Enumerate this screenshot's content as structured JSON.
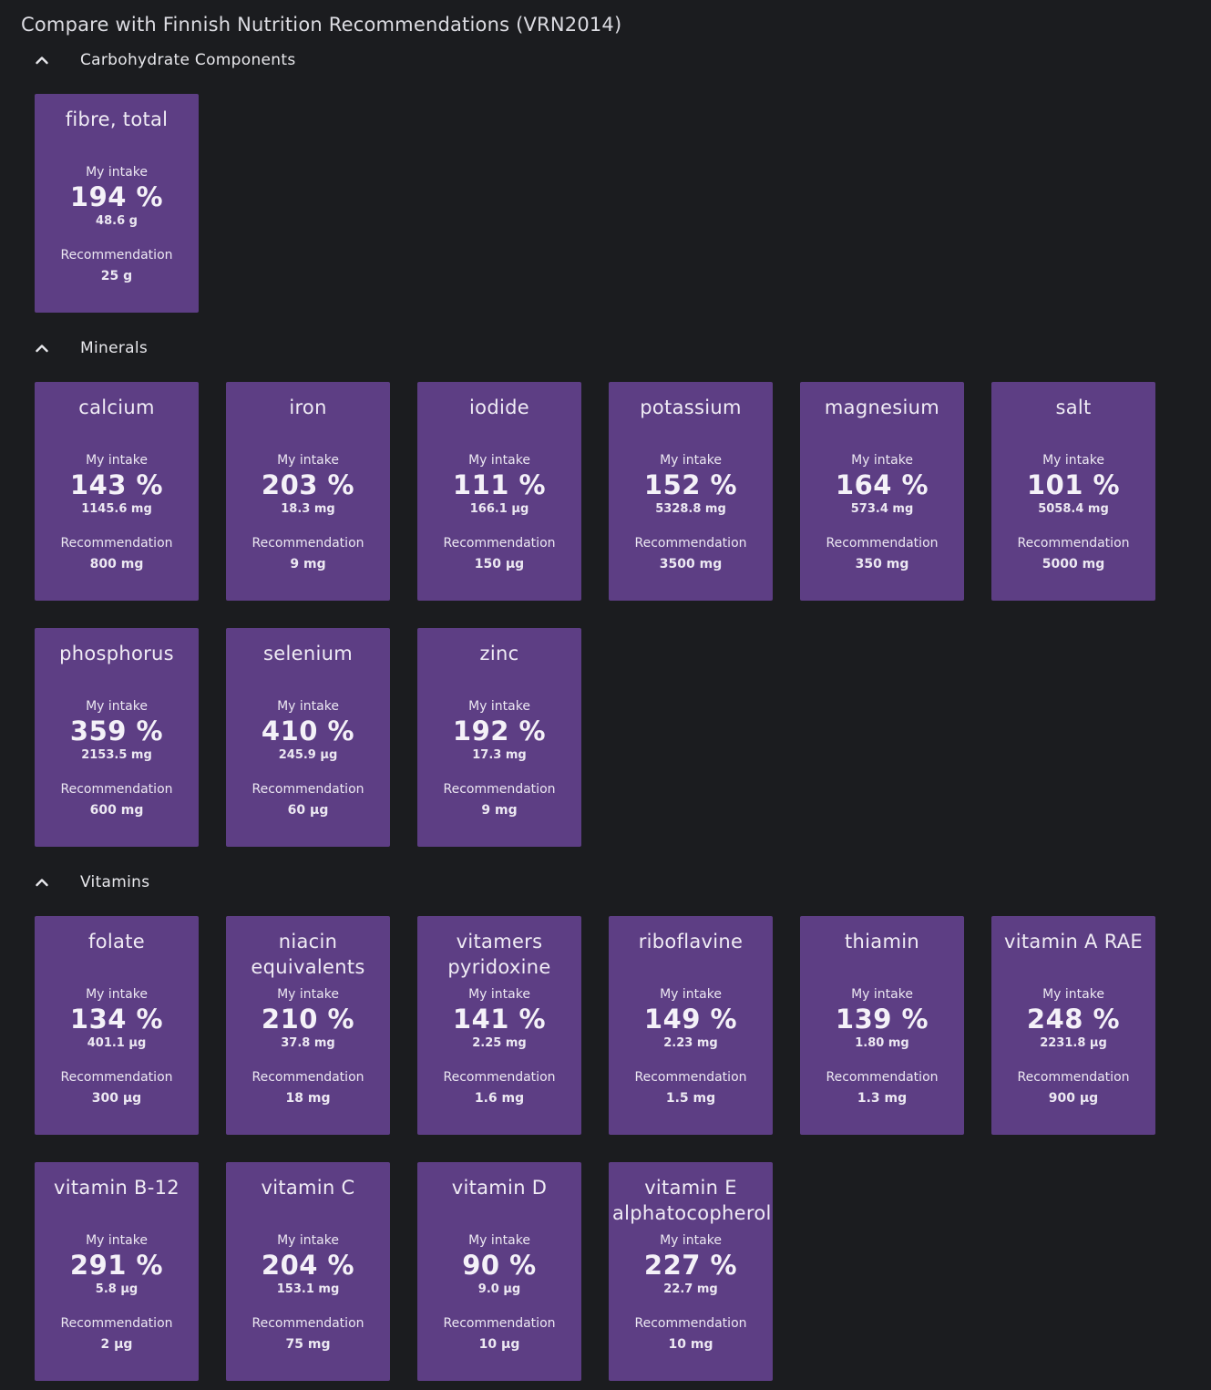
{
  "page": {
    "title": "Compare with Finnish Nutrition Recommendations (VRN2014)"
  },
  "labels": {
    "my_intake": "My intake",
    "recommendation": "Recommendation"
  },
  "sections": [
    {
      "label": "Carbohydrate Components",
      "expanded": true,
      "cards": [
        {
          "name": "fibre, total",
          "percent": "194 %",
          "intake": "48.6 g",
          "recommendation": "25 g"
        }
      ]
    },
    {
      "label": "Minerals",
      "expanded": true,
      "cards": [
        {
          "name": "calcium",
          "percent": "143 %",
          "intake": "1145.6 mg",
          "recommendation": "800 mg"
        },
        {
          "name": "iron",
          "percent": "203 %",
          "intake": "18.3 mg",
          "recommendation": "9 mg"
        },
        {
          "name": "iodide",
          "percent": "111 %",
          "intake": "166.1 µg",
          "recommendation": "150 µg"
        },
        {
          "name": "potassium",
          "percent": "152 %",
          "intake": "5328.8 mg",
          "recommendation": "3500 mg"
        },
        {
          "name": "magnesium",
          "percent": "164 %",
          "intake": "573.4 mg",
          "recommendation": "350 mg"
        },
        {
          "name": "salt",
          "percent": "101 %",
          "intake": "5058.4 mg",
          "recommendation": "5000 mg"
        },
        {
          "name": "phosphorus",
          "percent": "359 %",
          "intake": "2153.5 mg",
          "recommendation": "600 mg"
        },
        {
          "name": "selenium",
          "percent": "410 %",
          "intake": "245.9 µg",
          "recommendation": "60 µg"
        },
        {
          "name": "zinc",
          "percent": "192 %",
          "intake": "17.3 mg",
          "recommendation": "9 mg"
        }
      ]
    },
    {
      "label": "Vitamins",
      "expanded": true,
      "cards": [
        {
          "name": "folate",
          "percent": "134 %",
          "intake": "401.1 µg",
          "recommendation": "300 µg"
        },
        {
          "name": "niacin equivalents",
          "percent": "210 %",
          "intake": "37.8 mg",
          "recommendation": "18 mg"
        },
        {
          "name": "vitamers pyridoxine",
          "percent": "141 %",
          "intake": "2.25 mg",
          "recommendation": "1.6 mg"
        },
        {
          "name": "riboflavine",
          "percent": "149 %",
          "intake": "2.23 mg",
          "recommendation": "1.5 mg"
        },
        {
          "name": "thiamin",
          "percent": "139 %",
          "intake": "1.80 mg",
          "recommendation": "1.3 mg"
        },
        {
          "name": "vitamin A RAE",
          "percent": "248 %",
          "intake": "2231.8 µg",
          "recommendation": "900 µg"
        },
        {
          "name": "vitamin B-12",
          "percent": "291 %",
          "intake": "5.8 µg",
          "recommendation": "2 µg"
        },
        {
          "name": "vitamin C",
          "percent": "204 %",
          "intake": "153.1 mg",
          "recommendation": "75 mg"
        },
        {
          "name": "vitamin D",
          "percent": "90 %",
          "intake": "9.0 µg",
          "recommendation": "10 µg"
        },
        {
          "name": "vitamin E alphatocopherol",
          "percent": "227 %",
          "intake": "22.7 mg",
          "recommendation": "10 mg"
        }
      ]
    }
  ],
  "theme": {
    "background": "#1b1c1f",
    "card": "#5d3e84",
    "text": "#e8e8ec"
  },
  "icons": {
    "section_toggle": "chevron-up-icon"
  }
}
